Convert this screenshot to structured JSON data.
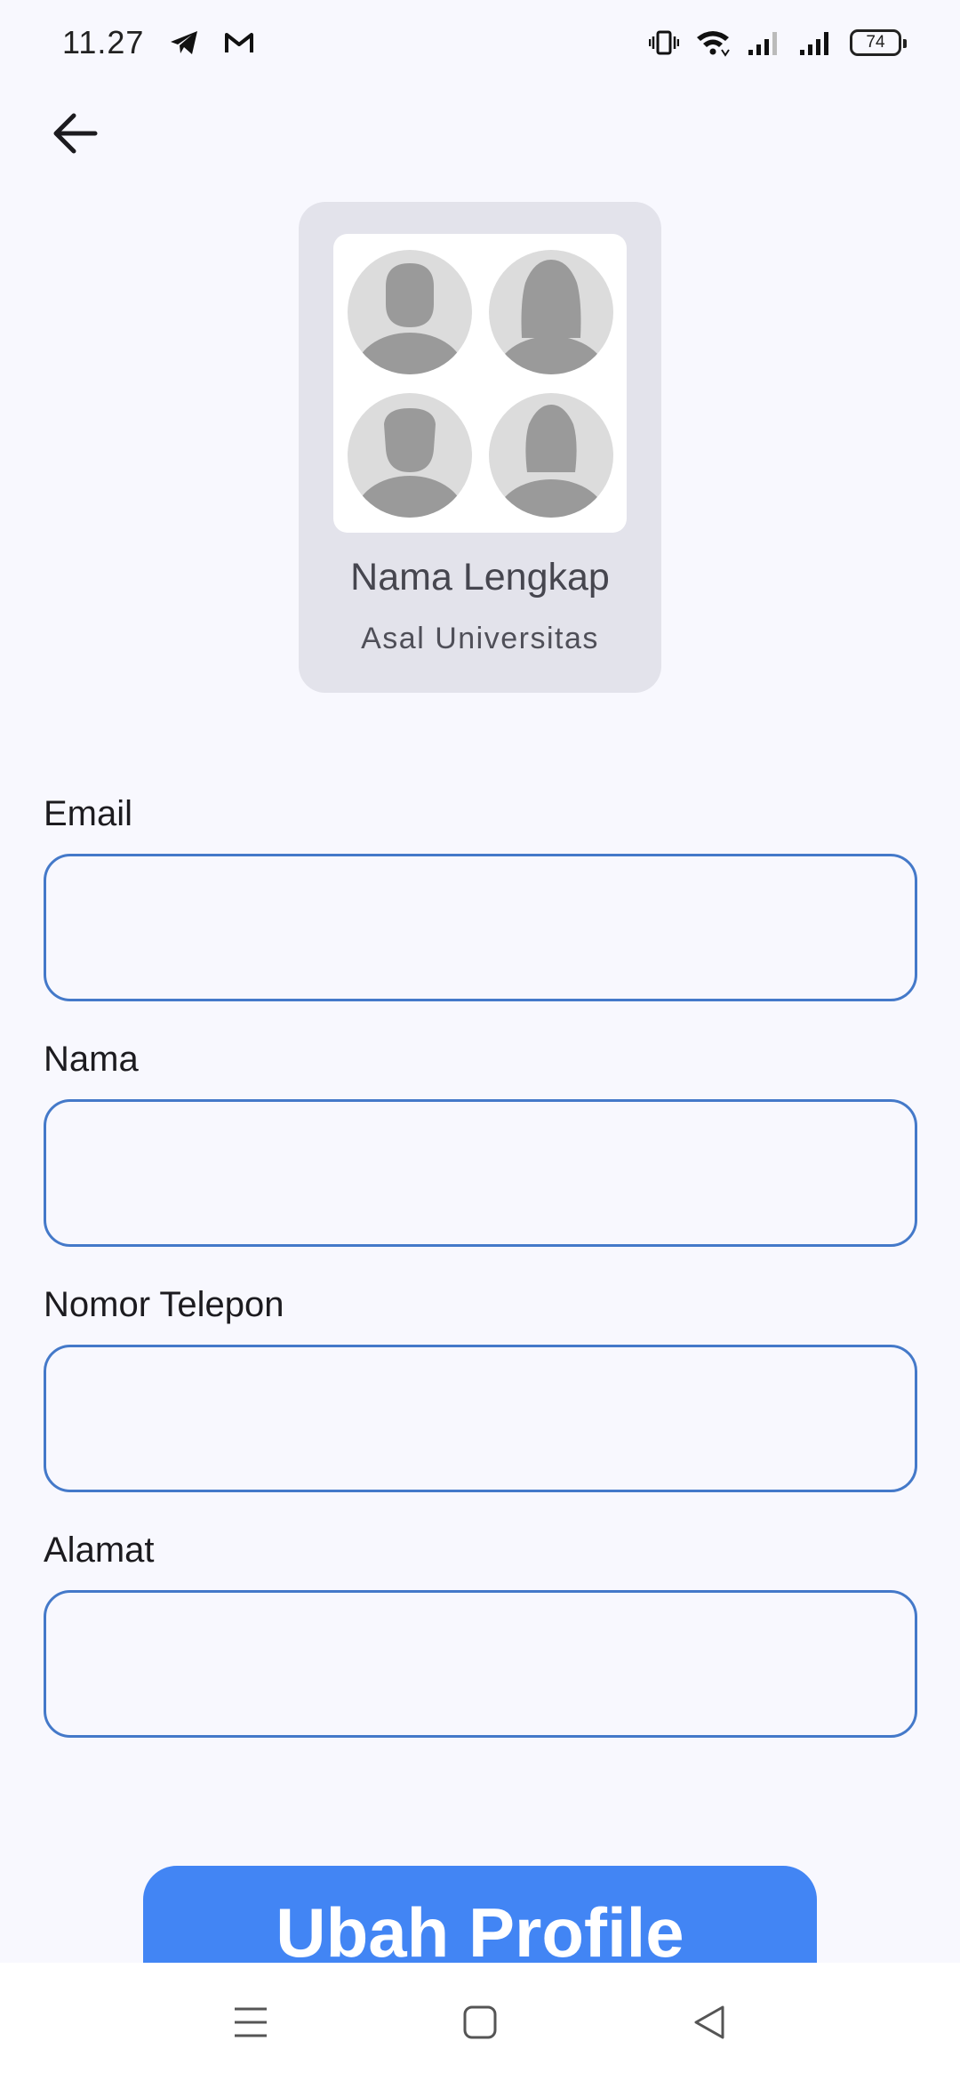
{
  "status_bar": {
    "time": "11.27",
    "battery": "74",
    "icons": [
      "telegram-icon",
      "gmail-icon",
      "vibrate-icon",
      "wifi-icon",
      "signal-icon",
      "signal-icon",
      "battery-icon"
    ]
  },
  "header": {
    "back_icon": "arrow-left-icon"
  },
  "profile": {
    "name": "Nama Lengkap",
    "university": "Asal Universitas",
    "avatars": [
      "male-avatar",
      "female-avatar",
      "male-avatar",
      "female-avatar"
    ]
  },
  "form": {
    "fields": [
      {
        "label": "Email",
        "value": "",
        "placeholder": ""
      },
      {
        "label": "Nama",
        "value": "",
        "placeholder": ""
      },
      {
        "label": "Nomor Telepon",
        "value": "",
        "placeholder": ""
      },
      {
        "label": "Alamat",
        "value": "",
        "placeholder": ""
      }
    ],
    "submit_label": "Ubah Profile"
  },
  "nav": {
    "icons": [
      "menu-icon",
      "home-icon",
      "back-triangle-icon"
    ]
  },
  "colors": {
    "background": "#f8f8fe",
    "card": "#e3e3eb",
    "input_border": "#4479c9",
    "primary": "#4285f4"
  }
}
